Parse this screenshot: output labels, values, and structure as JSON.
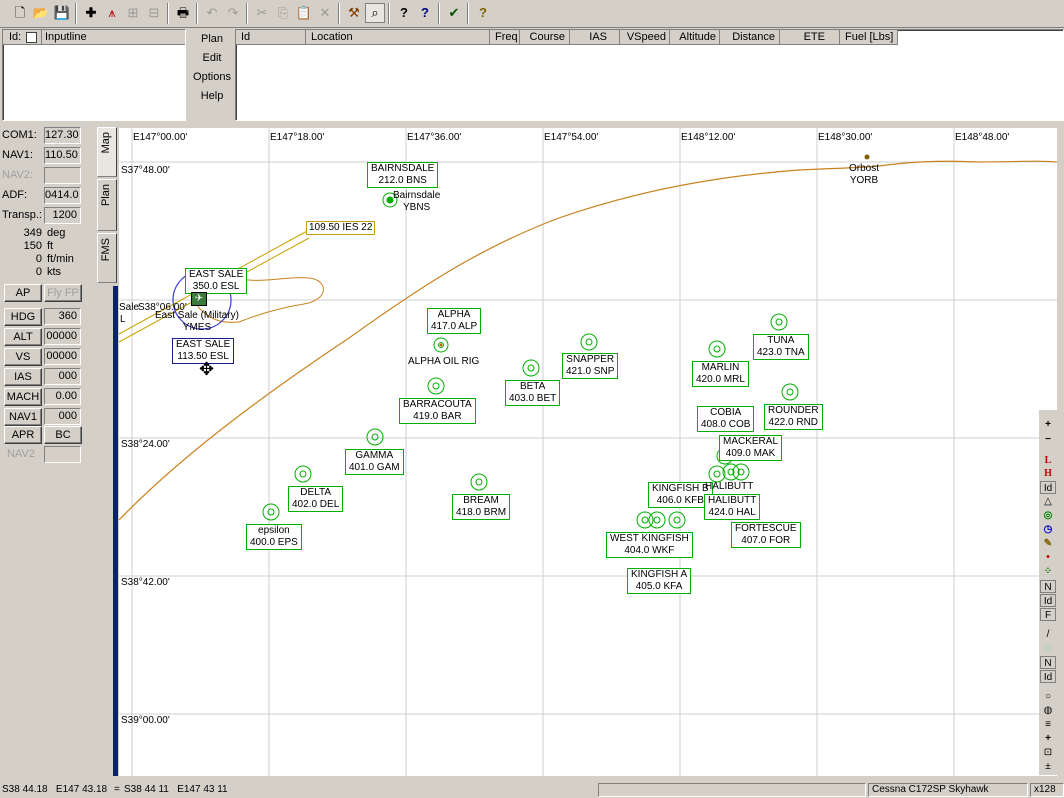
{
  "toolbar": {
    "icons": [
      "new-file",
      "open-folder",
      "save",
      "add",
      "flight-plan",
      "insert",
      "remove",
      "print",
      "undo",
      "redo",
      "cut",
      "copy",
      "paste",
      "delete",
      "tools",
      "search-map",
      "help",
      "help-context",
      "check-user",
      "about"
    ]
  },
  "top": {
    "id_label": "Id:",
    "inputline_label": "Inputline",
    "menu": [
      "Plan",
      "Edit",
      "Options",
      "Help"
    ],
    "columns": [
      "Id",
      "Location",
      "Freq",
      "Course",
      "IAS",
      "VSpeed",
      "Altitude",
      "Distance",
      "ETE",
      "Fuel [Lbs]"
    ]
  },
  "radios": [
    {
      "label": "COM1:",
      "value": "127.30",
      "enabled": true
    },
    {
      "label": "NAV1:",
      "value": "110.50",
      "enabled": true
    },
    {
      "label": "NAV2:",
      "value": "",
      "enabled": false
    },
    {
      "label": "ADF:",
      "value": "0414.0",
      "enabled": true
    },
    {
      "label": "Transp.:",
      "value": "1200",
      "enabled": true
    }
  ],
  "readouts": [
    {
      "value": "349",
      "unit": "deg"
    },
    {
      "value": "150",
      "unit": "ft"
    },
    {
      "value": "0",
      "unit": "ft/min"
    },
    {
      "value": "0",
      "unit": "kts"
    }
  ],
  "autopilot": {
    "ap": "AP",
    "flyfp": "Fly FP",
    "rows": [
      {
        "label": "HDG",
        "value": "360"
      },
      {
        "label": "ALT",
        "value": "00000"
      },
      {
        "label": "VS",
        "value": "00000"
      },
      {
        "label": "IAS",
        "value": "000"
      },
      {
        "label": "MACH",
        "value": "0.00"
      },
      {
        "label": "NAV1",
        "value": "000"
      }
    ],
    "apr": "APR",
    "bc": "BC",
    "nav2": "NAV2"
  },
  "tabs": [
    "Map",
    "Plan",
    "FMS"
  ],
  "map": {
    "lon_labels": [
      "E147°00.00'",
      "E147°18.00'",
      "E147°36.00'",
      "E147°54.00'",
      "E148°12.00'",
      "E148°30.00'",
      "E148°48.00'"
    ],
    "lat_labels": [
      "S37°48.00'",
      "S38°06.00'",
      "S38°24.00'",
      "S38°42.00'",
      "S39°00.00'"
    ],
    "sale_prefix": "Sale",
    "sale_suffix": "L",
    "navaids": [
      {
        "name": "BAIRNSDALE",
        "freq": "212.0 BNS"
      },
      {
        "name": "EAST SALE",
        "freq": "350.0 ESL"
      },
      {
        "name": "EAST SALE",
        "freq": "113.50 ESL"
      },
      {
        "name": "ALPHA",
        "freq": "417.0 ALP"
      },
      {
        "name": "SNAPPER",
        "freq": "421.0 SNP"
      },
      {
        "name": "BETA",
        "freq": "403.0 BET"
      },
      {
        "name": "BARRACOUTA",
        "freq": "419.0 BAR"
      },
      {
        "name": "TUNA",
        "freq": "423.0 TNA"
      },
      {
        "name": "MARLIN",
        "freq": "420.0 MRL"
      },
      {
        "name": "ROUNDER",
        "freq": "422.0 RND"
      },
      {
        "name": "COBIA",
        "freq": "408.0 COB"
      },
      {
        "name": "MACKERAL",
        "freq": "409.0 MAK"
      },
      {
        "name": "GAMMA",
        "freq": "401.0 GAM"
      },
      {
        "name": "DELTA",
        "freq": "402.0 DEL"
      },
      {
        "name": "BREAM",
        "freq": "418.0 BRM"
      },
      {
        "name": "KINGFISH B",
        "freq": "406.0 KFB"
      },
      {
        "name": "HALIBUTT",
        "freq": "424.0 HAL"
      },
      {
        "name": "epsilon",
        "freq": "400.0 EPS"
      },
      {
        "name": "WEST KINGFISH",
        "freq": "404.0 WKF"
      },
      {
        "name": "FORTESCUE",
        "freq": "407.0 FOR"
      },
      {
        "name": "KINGFISH A",
        "freq": "405.0 KFA"
      }
    ],
    "halibutt_label": "HALIBUTT",
    "ils_label": "109.50 IES 22",
    "airports": [
      {
        "name": "Bairnsdale",
        "code": "YBNS"
      },
      {
        "name": "East Sale (Military)",
        "code": "YMES"
      },
      {
        "name": "Orbost",
        "code": "YORB"
      }
    ],
    "alpha_oil_rig": "ALPHA OIL RIG"
  },
  "right_tools": [
    "+",
    "−",
    "L",
    "H",
    "Id",
    "△",
    "◎",
    "◷",
    "✎",
    "•",
    "⁘",
    "N",
    "Id",
    "F",
    "/",
    "◌",
    "N",
    "Id",
    "○",
    "◍",
    "≡",
    "+",
    "⊡",
    "±"
  ],
  "status": {
    "pos1": "S38 44.18   E147 43.18",
    "eq": "=",
    "pos2": "S38 44 11   E147 43 11",
    "aircraft": "Cessna C172SP Skyhawk",
    "zoom": "x128"
  },
  "colors": {
    "navaid": "#00b000",
    "vortac": "#1a1a8c",
    "coast": "#c8821e",
    "ils": "#c8a000",
    "airport_circle": "#3a3ad0"
  }
}
